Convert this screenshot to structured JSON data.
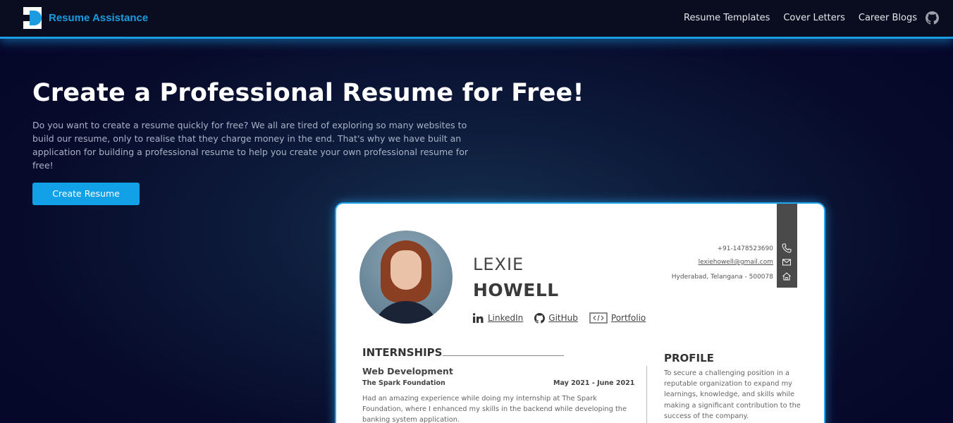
{
  "nav": {
    "brand": "Resume Assistance",
    "links": [
      "Resume Templates",
      "Cover Letters",
      "Career Blogs"
    ],
    "github_icon": "github-icon"
  },
  "hero": {
    "title": "Create a Professional Resume for Free!",
    "description": "Do you want to create a resume quickly for free? We all are tired of exploring so many websites to build our resume, only to realise that they charge money in the end. That's why we have built an application for building a professional resume to help you create your own professional resume for free!",
    "cta_label": "Create Resume"
  },
  "resume": {
    "first_name": "LEXIE",
    "last_name": "HOWELL",
    "socials": [
      {
        "icon": "linkedin-icon",
        "label": "LinkedIn"
      },
      {
        "icon": "github-icon",
        "label": "GitHub"
      },
      {
        "icon": "code-icon",
        "label": "Portfolio"
      }
    ],
    "contact": {
      "phone": "+91-1478523690",
      "email": "lexiehowell@gmail.com",
      "address": "Hyderabad, Telangana -  500078"
    },
    "internships": {
      "heading": "INTERNSHIPS",
      "title": "Web Development",
      "company": "The Spark Foundation",
      "dates": "May 2021 - June 2021",
      "description": "Had an amazing experience while doing my internship at The Spark Foundation, where I enhanced my skills in the backend while developing the banking system application."
    },
    "profile": {
      "heading": "PROFILE",
      "text": "To secure a challenging position in a reputable organization to expand my learnings, knowledge, and skills while making a significant contribution to the success of the company."
    }
  },
  "colors": {
    "accent": "#1b9be0",
    "button": "#12a1e6",
    "nav_bg": "#0a0d1f",
    "page_bg": "#070a2a"
  }
}
